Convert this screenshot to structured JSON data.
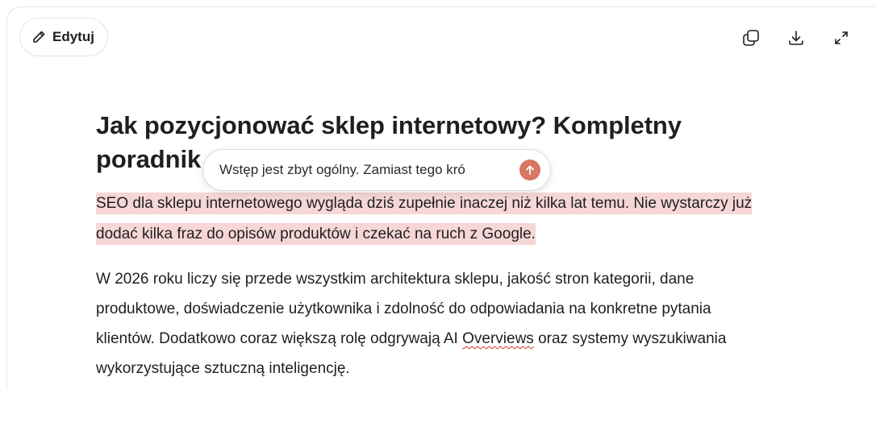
{
  "toolbar": {
    "edit_label": "Edytuj",
    "icons": [
      "pencil-icon",
      "copy-icon",
      "download-icon",
      "expand-icon"
    ]
  },
  "document": {
    "title": "Jak pozycjonować sklep internetowy? Kompletny poradnik",
    "paragraph1": "SEO dla sklepu internetowego wygląda dziś zupełnie inaczej niż kilka lat temu. Nie wystarczy już dodać kilka fraz do opisów produktów i czekać na ruch z Google.",
    "paragraph2_before": "W 2026 roku liczy się przede wszystkim architektura sklepu, jakość stron kategorii, dane produktowe, doświadczenie użytkownika i zdolność do odpowiadania na konkretne pytania klientów. Dodatkowo coraz większą rolę odgrywają AI ",
    "paragraph2_misspelled": "Overviews",
    "paragraph2_after": " oraz systemy wyszukiwania wykorzystujące sztuczną inteligencję."
  },
  "comment": {
    "value": "Wstęp jest zbyt ogólny. Zamiast tego kró"
  },
  "colors": {
    "highlight": "#f6d6d6",
    "send_button": "#d97563",
    "spellcheck": "#d93025"
  }
}
